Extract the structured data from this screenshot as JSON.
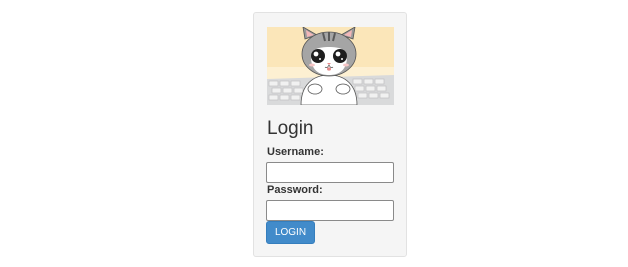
{
  "login": {
    "title": "Login",
    "username_label": "Username:",
    "username_value": "",
    "password_label": "Password:",
    "password_value": "",
    "submit_label": "LOGIN"
  },
  "banner": {
    "icon": "kitten-on-keyboard-illustration"
  },
  "colors": {
    "panel_background": "#f5f5f5",
    "button_background": "#428bca",
    "button_text": "#ffffff",
    "banner_background": "#fdf0d2"
  }
}
